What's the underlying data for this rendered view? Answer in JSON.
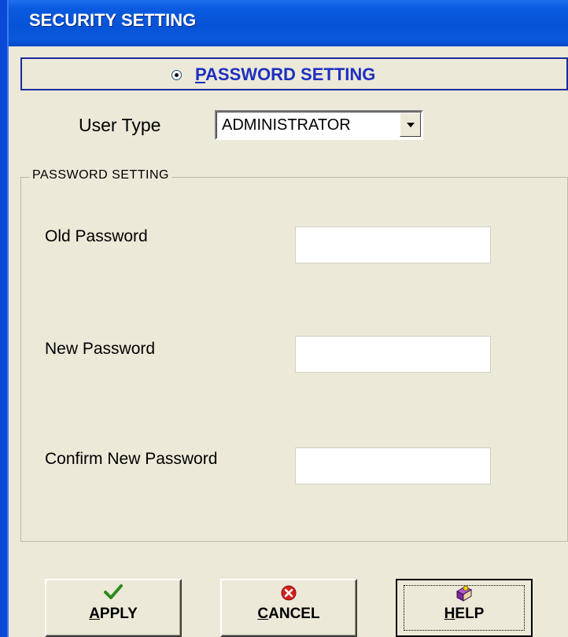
{
  "window": {
    "title": "SECURITY SETTING"
  },
  "radio": {
    "accel": "P",
    "rest": "ASSWORD SETTING",
    "selected": true
  },
  "user_type": {
    "label": "User Type",
    "value": "ADMINISTRATOR"
  },
  "group": {
    "title": "PASSWORD SETTING",
    "fields": [
      {
        "label": "Old Password",
        "value": ""
      },
      {
        "label": "New Password",
        "value": ""
      },
      {
        "label": "Confirm New Password",
        "value": ""
      }
    ]
  },
  "buttons": {
    "apply": {
      "accel": "A",
      "rest": "PPLY",
      "icon": "check-icon"
    },
    "cancel": {
      "accel": "C",
      "rest": "ANCEL",
      "icon": "cancel-x-icon"
    },
    "help": {
      "accel": "H",
      "rest": "ELP",
      "icon": "help-book-icon"
    }
  },
  "colors": {
    "titlebar": "#0753d6",
    "radio_label": "#1d2fc1",
    "check": "#2e8b1e",
    "cancel": "#d42020"
  }
}
